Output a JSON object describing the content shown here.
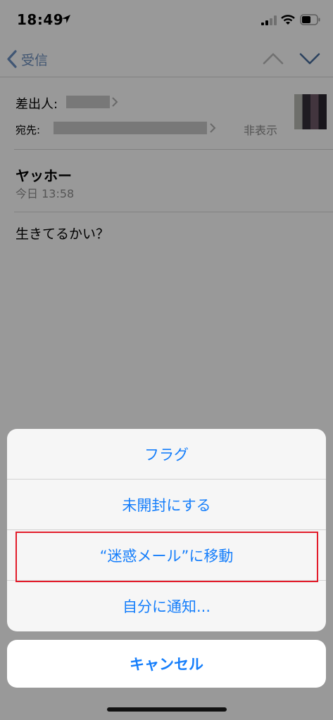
{
  "status": {
    "time": "18:49"
  },
  "nav": {
    "back_label": "受信"
  },
  "header": {
    "from_label": "差出人:",
    "to_label": "宛先:",
    "hide_label": "非表示"
  },
  "message": {
    "subject": "ヤッホー",
    "date": "今日 13:58",
    "body": "生きてるかい？"
  },
  "action_sheet": {
    "items": [
      {
        "label": "フラグ"
      },
      {
        "label": "未開封にする"
      },
      {
        "label": "“迷惑メール”に移動"
      },
      {
        "label": "自分に通知..."
      }
    ],
    "cancel_label": "キャンセル",
    "accent_color": "#157efb",
    "highlight_color": "#e21b2a"
  }
}
